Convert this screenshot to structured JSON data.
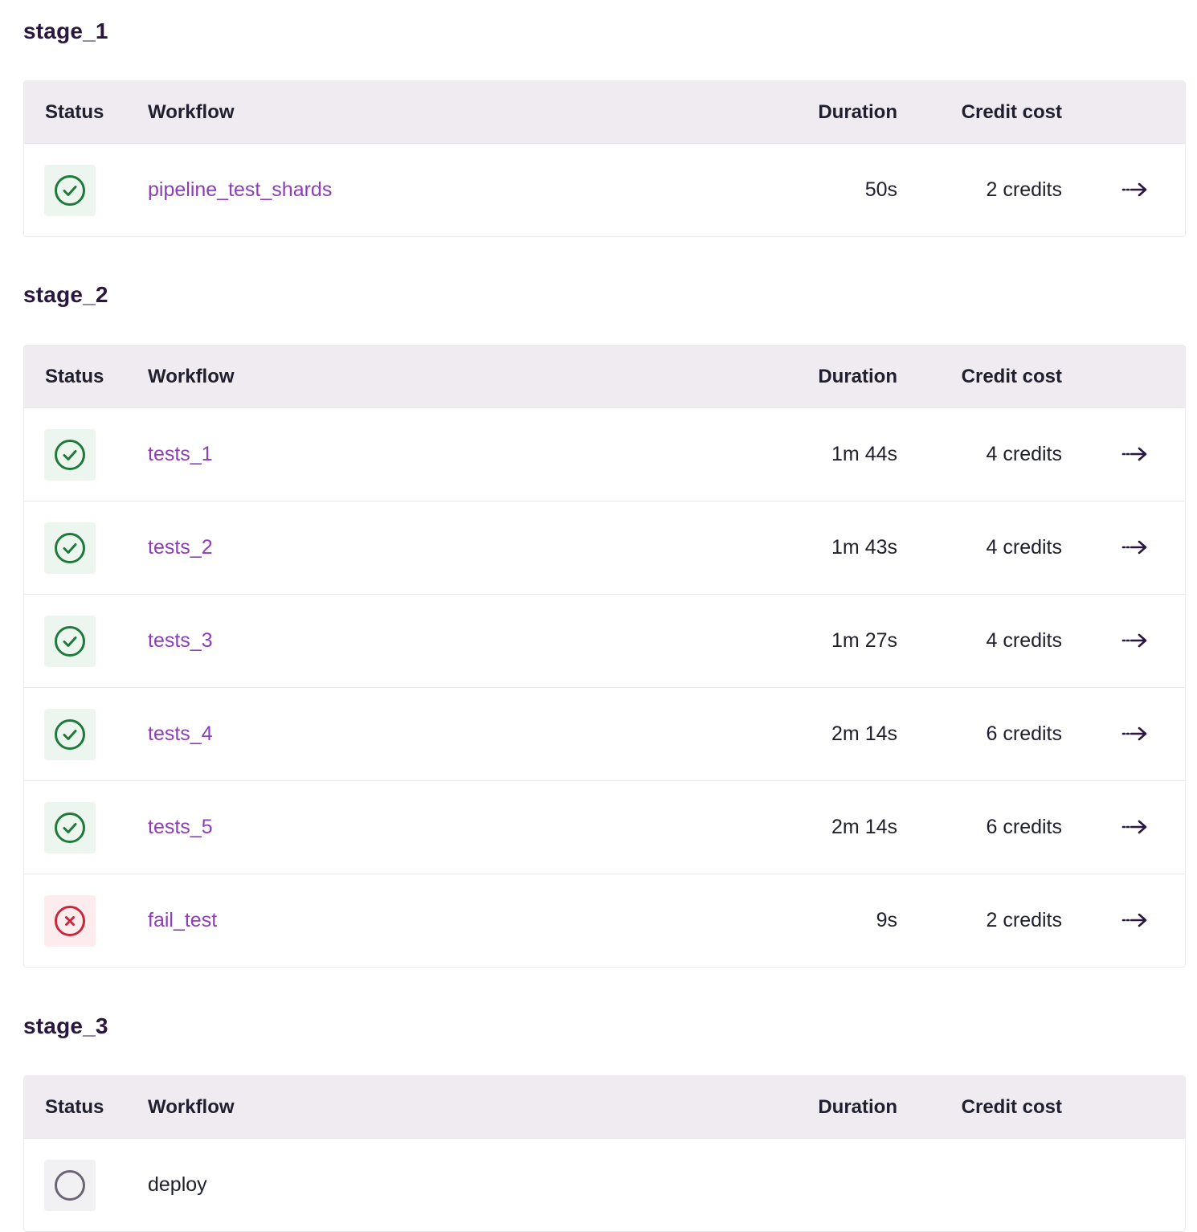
{
  "columns": {
    "status": "Status",
    "workflow": "Workflow",
    "duration": "Duration",
    "credit": "Credit cost"
  },
  "colors": {
    "success": "#1e7a3c",
    "failed": "#c8283c",
    "pending": "#6b6474",
    "link": "#8c3db8",
    "title": "#2a1740"
  },
  "stages": [
    {
      "title": "stage_1",
      "rows": [
        {
          "status": "success",
          "status_icon": "check-circle-icon",
          "workflow": "pipeline_test_shards",
          "duration": "50s",
          "credits": "2 credits",
          "link": true
        }
      ]
    },
    {
      "title": "stage_2",
      "rows": [
        {
          "status": "success",
          "status_icon": "check-circle-icon",
          "workflow": "tests_1",
          "duration": "1m 44s",
          "credits": "4 credits",
          "link": true
        },
        {
          "status": "success",
          "status_icon": "check-circle-icon",
          "workflow": "tests_2",
          "duration": "1m 43s",
          "credits": "4 credits",
          "link": true
        },
        {
          "status": "success",
          "status_icon": "check-circle-icon",
          "workflow": "tests_3",
          "duration": "1m 27s",
          "credits": "4 credits",
          "link": true
        },
        {
          "status": "success",
          "status_icon": "check-circle-icon",
          "workflow": "tests_4",
          "duration": "2m 14s",
          "credits": "6 credits",
          "link": true
        },
        {
          "status": "success",
          "status_icon": "check-circle-icon",
          "workflow": "tests_5",
          "duration": "2m 14s",
          "credits": "6 credits",
          "link": true
        },
        {
          "status": "failed",
          "status_icon": "x-circle-icon",
          "workflow": "fail_test",
          "duration": "9s",
          "credits": "2 credits",
          "link": true
        }
      ]
    },
    {
      "title": "stage_3",
      "rows": [
        {
          "status": "pending",
          "status_icon": "empty-circle-icon",
          "workflow": "deploy",
          "duration": "",
          "credits": "",
          "link": false
        }
      ]
    }
  ]
}
